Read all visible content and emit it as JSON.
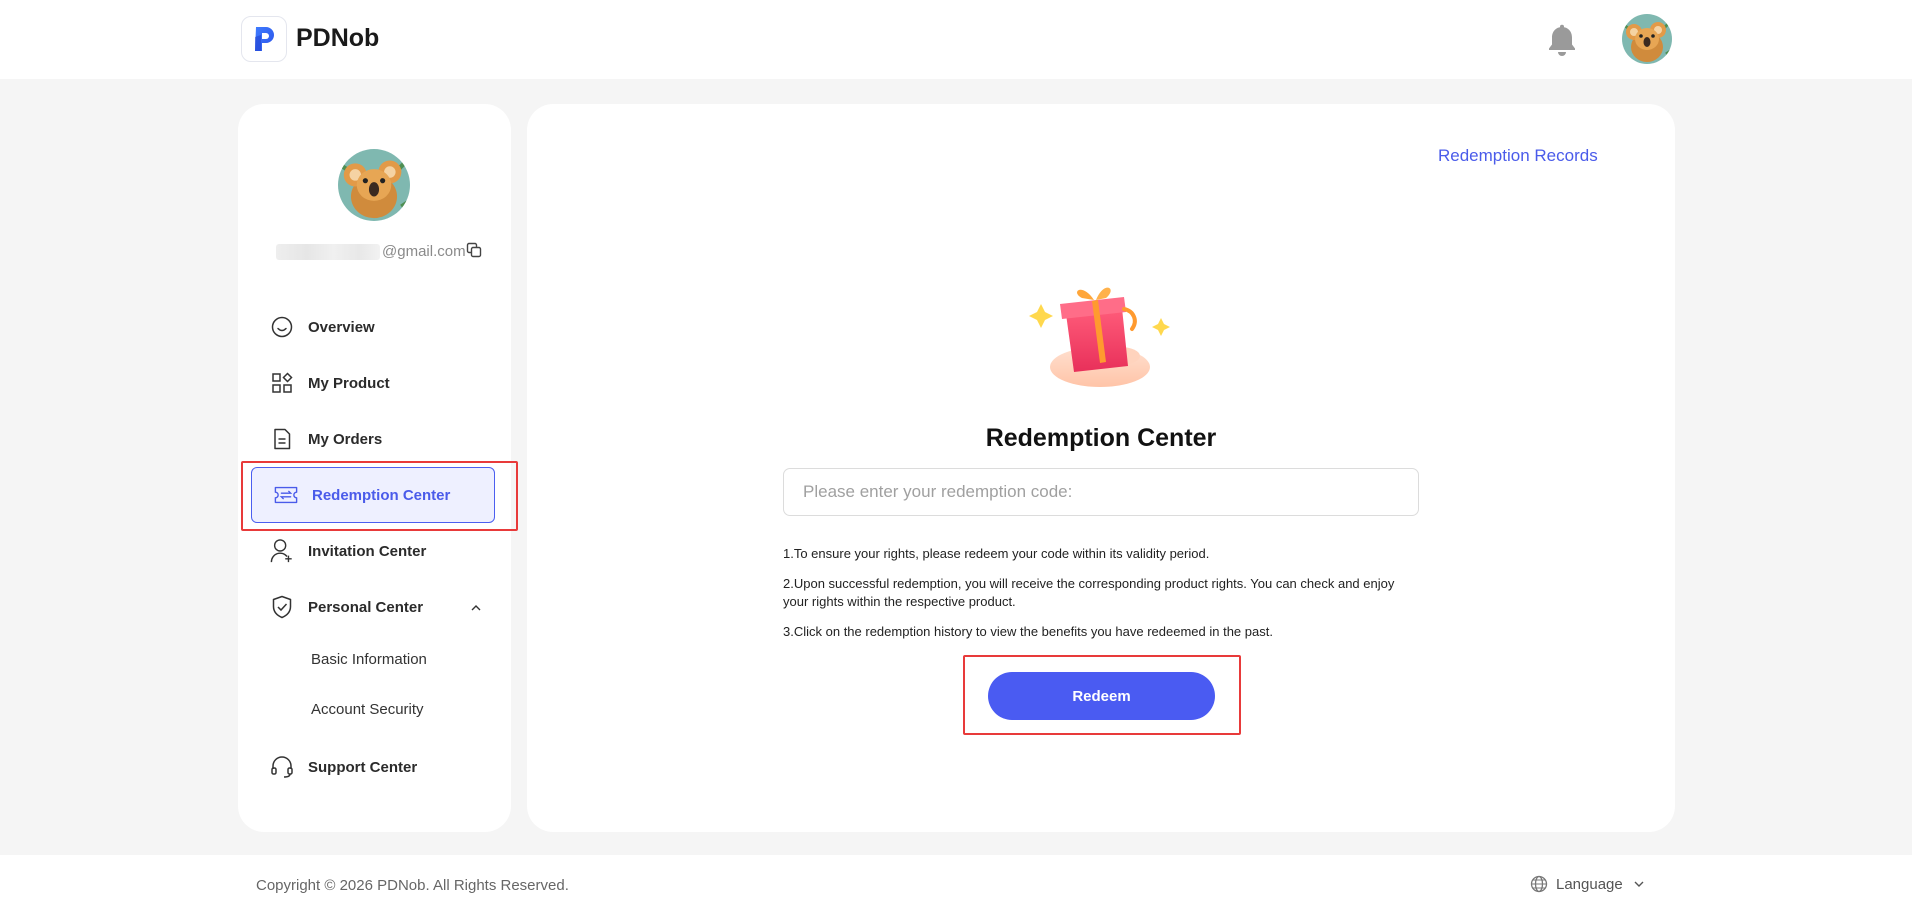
{
  "header": {
    "logo_letter": "P",
    "brand": "PDNob",
    "icons": {
      "logo": "p-logo-icon",
      "notifications": "bell-icon",
      "avatar": "koala-avatar"
    }
  },
  "sidebar": {
    "email_domain": "@gmail.com",
    "items": [
      {
        "label": "Overview",
        "icon": "smile-face-icon"
      },
      {
        "label": "My Product",
        "icon": "grid-shapes-icon"
      },
      {
        "label": "My Orders",
        "icon": "document-icon"
      },
      {
        "label": "Redemption Center",
        "icon": "ticket-icon",
        "active": true
      },
      {
        "label": "Invitation Center",
        "icon": "user-plus-icon"
      },
      {
        "label": "Personal Center",
        "icon": "shield-check-icon",
        "expanded": true
      },
      {
        "label": "Support Center",
        "icon": "headset-icon"
      }
    ],
    "sub_items": [
      {
        "label": "Basic Information"
      },
      {
        "label": "Account Security"
      }
    ]
  },
  "main": {
    "records_link": "Redemption Records",
    "title": "Redemption Center",
    "input_placeholder": "Please enter your redemption code:",
    "notes": [
      "1.To ensure your rights, please redeem your code within its validity period.",
      "2.Upon successful redemption, you will receive the corresponding product rights. You can check and enjoy your rights within the respective product.",
      "3.Click on the redemption history to view the benefits you have redeemed in the past."
    ],
    "redeem_label": "Redeem"
  },
  "footer": {
    "copyright": "Copyright © 2026 PDNob. All Rights Reserved.",
    "language": "Language"
  },
  "colors": {
    "accent": "#4a5bf2",
    "highlight_box": "#e83a3a",
    "active_bg": "#eef0ff"
  }
}
